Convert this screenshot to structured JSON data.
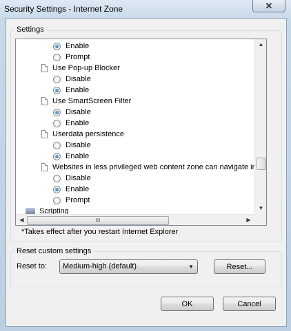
{
  "window": {
    "title": "Security Settings - Internet Zone",
    "close_glyph": "✕"
  },
  "settings_group": {
    "label": "Settings"
  },
  "tree": [
    {
      "kind": "radio",
      "label": "Enable",
      "checked": true
    },
    {
      "kind": "radio",
      "label": "Prompt",
      "checked": false
    },
    {
      "kind": "header",
      "label": "Use Pop-up Blocker"
    },
    {
      "kind": "radio",
      "label": "Disable",
      "checked": false
    },
    {
      "kind": "radio",
      "label": "Enable",
      "checked": true
    },
    {
      "kind": "header",
      "label": "Use SmartScreen Filter"
    },
    {
      "kind": "radio",
      "label": "Disable",
      "checked": true
    },
    {
      "kind": "radio",
      "label": "Enable",
      "checked": false
    },
    {
      "kind": "header",
      "label": "Userdata persistence"
    },
    {
      "kind": "radio",
      "label": "Disable",
      "checked": false
    },
    {
      "kind": "radio",
      "label": "Enable",
      "checked": true
    },
    {
      "kind": "header",
      "label": "Websites in less privileged web content zone can navigate in"
    },
    {
      "kind": "radio",
      "label": "Disable",
      "checked": false
    },
    {
      "kind": "radio",
      "label": "Enable",
      "checked": true
    },
    {
      "kind": "radio",
      "label": "Prompt",
      "checked": false
    },
    {
      "kind": "category",
      "label": "Scripting"
    }
  ],
  "scrollbars": {
    "up": "▲",
    "down": "▼",
    "left": "◀",
    "right": "▶",
    "grip": "III"
  },
  "note": "*Takes effect after you restart Internet Explorer",
  "reset_group": {
    "label": "Reset custom settings",
    "reset_to_label": "Reset to:",
    "selected_level": "Medium-high (default)",
    "dropdown_arrow": "▼",
    "reset_button": "Reset..."
  },
  "footer": {
    "ok": "OK",
    "cancel": "Cancel"
  }
}
